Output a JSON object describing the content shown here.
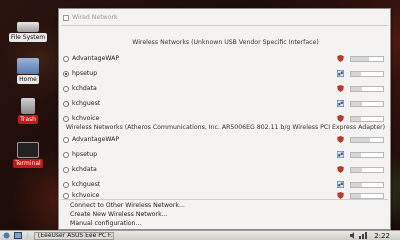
{
  "desktop": {
    "icons": [
      {
        "label": "File System"
      },
      {
        "label": "Home"
      },
      {
        "label": "Trash"
      },
      {
        "label": "Terminal"
      }
    ]
  },
  "menu": {
    "wired": "Wired Network",
    "sections": [
      {
        "header": "Wireless Networks (Unknown USB Vendor Specific Interface)",
        "networks": [
          {
            "name": "AdvantageWAP",
            "selected": false,
            "secure": true,
            "signal": 0.55
          },
          {
            "name": "hpsetup",
            "selected": true,
            "secure": false,
            "signal": 0.3
          },
          {
            "name": "kchdata",
            "selected": false,
            "secure": true,
            "signal": 0.35
          },
          {
            "name": "kchguest",
            "selected": false,
            "secure": false,
            "signal": 0.35
          },
          {
            "name": "kchvoice",
            "selected": false,
            "secure": true,
            "signal": 0.3
          }
        ]
      },
      {
        "header": "Wireless Networks (Atheros Communications, Inc. AR5006EG 802.11 b/g Wireless PCI Express Adapter)",
        "networks": [
          {
            "name": "AdvantageWAP",
            "selected": false,
            "secure": true,
            "signal": 0.6
          },
          {
            "name": "hpsetup",
            "selected": false,
            "secure": false,
            "signal": 0.3
          },
          {
            "name": "kchdata",
            "selected": false,
            "secure": true,
            "signal": 0.35
          },
          {
            "name": "kchguest",
            "selected": false,
            "secure": false,
            "signal": 0.35
          },
          {
            "name": "kchvoice",
            "selected": false,
            "secure": true,
            "signal": 0.3
          }
        ]
      }
    ],
    "actions": [
      "Connect to Other Wireless Network...",
      "Create New Wireless Network...",
      "Manual configuration..."
    ]
  },
  "taskbar": {
    "task": "[EeeUser ASUS Eee PC F...",
    "clock": "2:22"
  },
  "colors": {
    "secure_icon": "#c0392b",
    "adhoc_icon": "#3a5a8a"
  }
}
